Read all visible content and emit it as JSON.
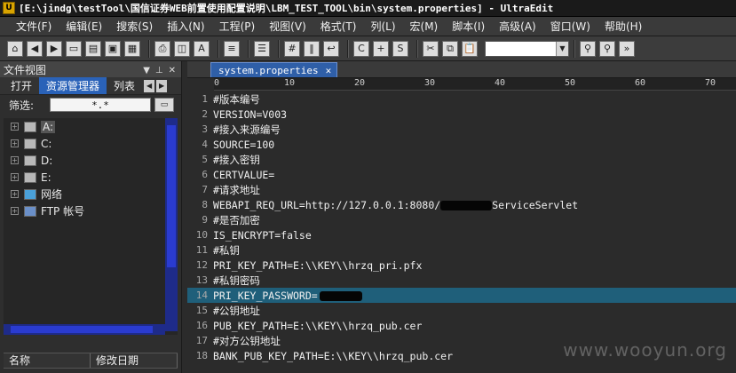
{
  "window": {
    "title": "[E:\\jindg\\testTool\\国信证券WEB前置使用配置说明\\LBM_TEST_TOOL\\bin\\system.properties] - UltraEdit"
  },
  "menu": [
    "文件(F)",
    "编辑(E)",
    "搜索(S)",
    "插入(N)",
    "工程(P)",
    "视图(V)",
    "格式(T)",
    "列(L)",
    "宏(M)",
    "脚本(I)",
    "高级(A)",
    "窗口(W)",
    "帮助(H)"
  ],
  "file_view": {
    "title": "文件视图",
    "tabs": [
      "打开",
      "资源管理器",
      "列表"
    ],
    "active_tab": "资源管理器",
    "filter_label": "筛选:",
    "filter_value": "*.*",
    "tree": [
      {
        "label": "A:",
        "icon": "floppy-drive-icon",
        "selected": true
      },
      {
        "label": "C:",
        "icon": "hard-drive-icon"
      },
      {
        "label": "D:",
        "icon": "cd-drive-icon"
      },
      {
        "label": "E:",
        "icon": "hard-drive-icon"
      },
      {
        "label": "网络",
        "icon": "network-icon"
      },
      {
        "label": "FTP 帐号",
        "icon": "ftp-icon"
      }
    ],
    "columns": [
      "名称",
      "修改日期"
    ]
  },
  "editor": {
    "tab_name": "system.properties",
    "ruler": [
      "0",
      "10",
      "20",
      "30",
      "40",
      "50",
      "60",
      "70"
    ],
    "highlight_line": 14,
    "lines": [
      {
        "n": "1",
        "text": "#版本编号"
      },
      {
        "n": "2",
        "text": "VERSION=V003"
      },
      {
        "n": "3",
        "text": "#接入来源编号"
      },
      {
        "n": "4",
        "text": "SOURCE=100"
      },
      {
        "n": "5",
        "text": "#接入密钥"
      },
      {
        "n": "6",
        "text": "CERTVALUE="
      },
      {
        "n": "7",
        "text": "#请求地址"
      },
      {
        "n": "8",
        "text": "WEBAPI_REQ_URL=http://127.0.0.1:8080/",
        "redacted": true,
        "suffix": "ServiceServlet"
      },
      {
        "n": "9",
        "text": "#是否加密"
      },
      {
        "n": "10",
        "text": "IS_ENCRYPT=false"
      },
      {
        "n": "11",
        "text": "#私钥"
      },
      {
        "n": "12",
        "text": "PRI_KEY_PATH=E:\\\\KEY\\\\hrzq_pri.pfx"
      },
      {
        "n": "13",
        "text": "#私钥密码"
      },
      {
        "n": "14",
        "text": "PRI_KEY_PASSWORD=",
        "redacted": true
      },
      {
        "n": "15",
        "text": "#公钥地址"
      },
      {
        "n": "16",
        "text": "PUB_KEY_PATH=E:\\\\KEY\\\\hrzq_pub.cer"
      },
      {
        "n": "17",
        "text": "#对方公钥地址"
      },
      {
        "n": "18",
        "text": "BANK_PUB_KEY_PATH=E:\\\\KEY\\\\hrzq_pub.cer"
      }
    ]
  },
  "watermark": "www.wooyun.org"
}
